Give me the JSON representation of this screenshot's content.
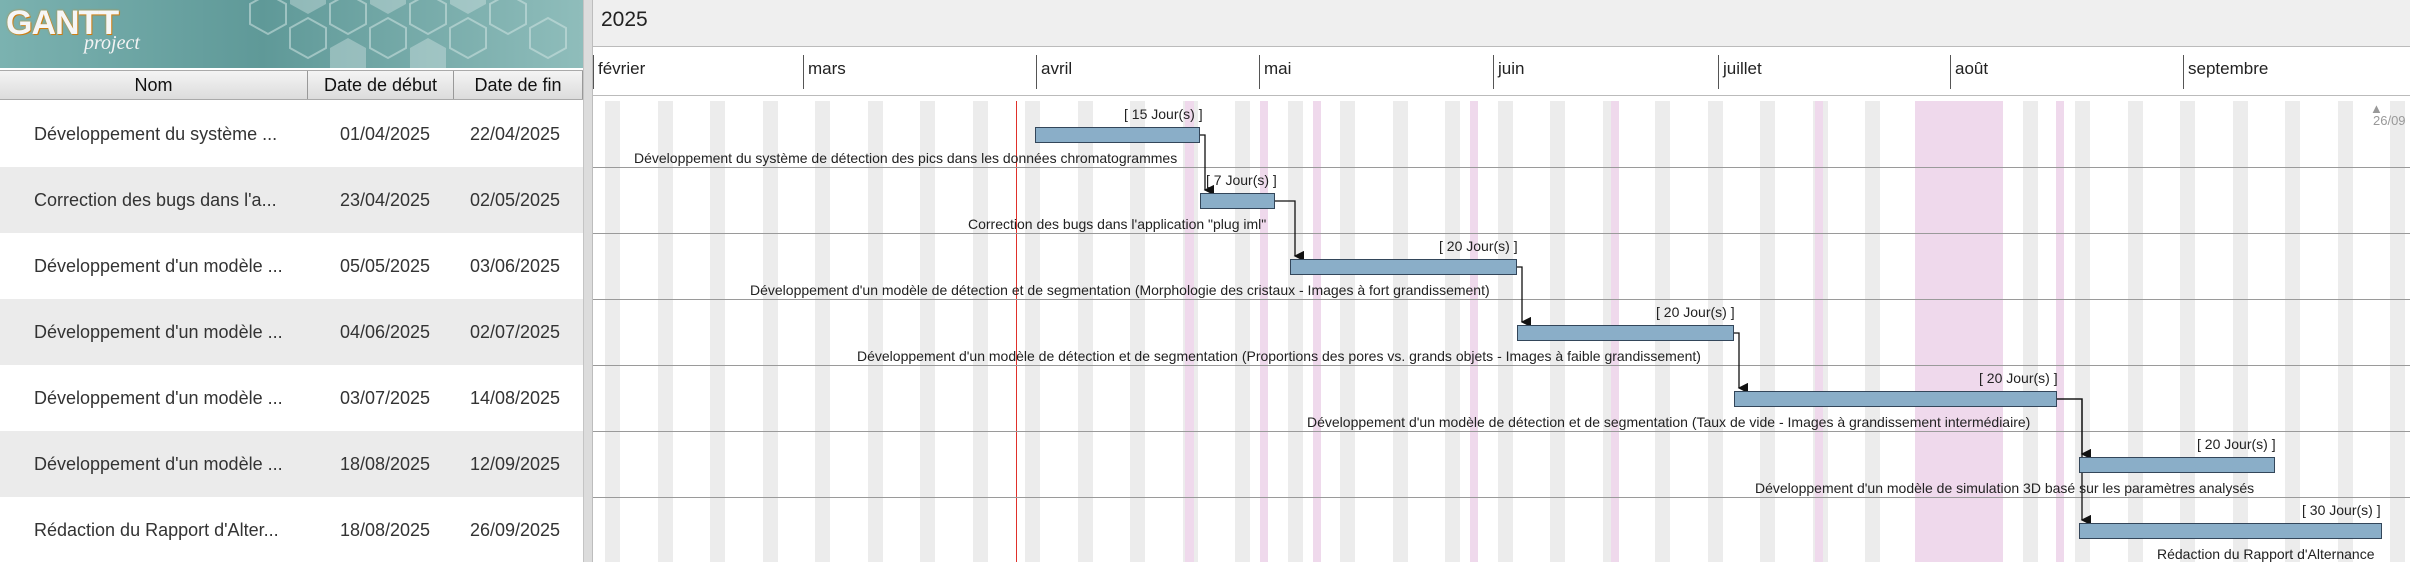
{
  "logo": {
    "title": "GANTT",
    "subtitle": "project"
  },
  "columns": {
    "name": "Nom",
    "start": "Date de début",
    "end": "Date de fin"
  },
  "tasks": [
    {
      "short": "Développement du système ...",
      "start": "01/04/2025",
      "end": "22/04/2025",
      "duration": "[ 15 Jour(s) ]",
      "full": "Développement du système de détection des pics dans les données chromatogrammes"
    },
    {
      "short": "Correction des bugs dans l'a...",
      "start": "23/04/2025",
      "end": "02/05/2025",
      "duration": "[ 7 Jour(s) ]",
      "full": "Correction des bugs dans l'application \"plug iml\""
    },
    {
      "short": "Développement d'un modèle ...",
      "start": "05/05/2025",
      "end": "03/06/2025",
      "duration": "[ 20 Jour(s) ]",
      "full": "Développement d'un modèle de détection et de segmentation (Morphologie des cristaux - Images à fort grandissement)"
    },
    {
      "short": "Développement d'un modèle ...",
      "start": "04/06/2025",
      "end": "02/07/2025",
      "duration": "[ 20 Jour(s) ]",
      "full": "Développement d'un modèle de détection et de segmentation (Proportions des pores vs. grands objets - Images à faible grandissement)"
    },
    {
      "short": "Développement d'un modèle ...",
      "start": "03/07/2025",
      "end": "14/08/2025",
      "duration": "[ 20 Jour(s) ]",
      "full": "Développement d'un modèle de détection et de segmentation (Taux de vide - Images à grandissement intermédiaire)"
    },
    {
      "short": "Développement d'un modèle ...",
      "start": "18/08/2025",
      "end": "12/09/2025",
      "duration": "[ 20 Jour(s) ]",
      "full": "Développement d'un modèle de simulation 3D basé sur les paramètres analysés"
    },
    {
      "short": "Rédaction du Rapport d'Alter...",
      "start": "18/08/2025",
      "end": "26/09/2025",
      "duration": "[ 30 Jour(s) ]",
      "full": "Rédaction du Rapport d'Alternance"
    }
  ],
  "timeline": {
    "year": "2025",
    "months": [
      "février",
      "mars",
      "avril",
      "mai",
      "juin",
      "juillet",
      "août",
      "septembre"
    ],
    "end_marker": "26/09"
  },
  "colors": {
    "bar": "#8aaec8",
    "bar_border": "#33465a",
    "today": "#e0302a",
    "holiday": "#efd9ec",
    "weekend": "#ececec"
  }
}
